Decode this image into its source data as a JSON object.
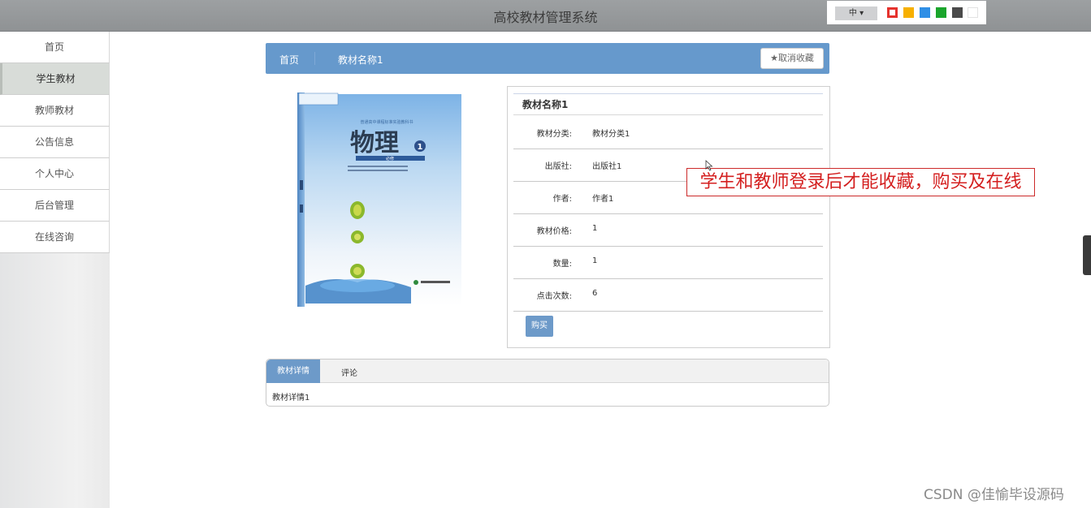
{
  "header": {
    "title": "高校教材管理系统",
    "lang_label": "中"
  },
  "theme_colors": [
    "#e5322d",
    "#f7b000",
    "#2f8fe6",
    "#1aa52c",
    "#4a4a4a",
    "#ffffff"
  ],
  "sidebar": {
    "items": [
      {
        "label": "首页"
      },
      {
        "label": "学生教材"
      },
      {
        "label": "教师教材"
      },
      {
        "label": "公告信息"
      },
      {
        "label": "个人中心"
      },
      {
        "label": "后台管理"
      },
      {
        "label": "在线咨询"
      }
    ]
  },
  "breadcrumb": {
    "home": "首页",
    "current": "教材名称1",
    "unfav_label": "取消收藏"
  },
  "cover": {
    "title": "物理",
    "volume": "1",
    "subtitle": "普通高中课程标准实验教科书",
    "badge": "必修"
  },
  "detail": {
    "heading": "教材名称1",
    "rows": [
      {
        "label": "教材分类:",
        "value": "教材分类1"
      },
      {
        "label": "出版社:",
        "value": "出版社1"
      },
      {
        "label": "作者:",
        "value": "作者1"
      },
      {
        "label": "教材价格:",
        "value": "1"
      },
      {
        "label": "数量:",
        "value": "1"
      },
      {
        "label": "点击次数:",
        "value": "6"
      }
    ],
    "buy_label": "购买"
  },
  "tabs": {
    "active": "教材详情",
    "other": "评论",
    "content": "教材详情1"
  },
  "annotation": "学生和教师登录后才能收藏，购买及在线",
  "watermark": "CSDN @佳愉毕设源码"
}
